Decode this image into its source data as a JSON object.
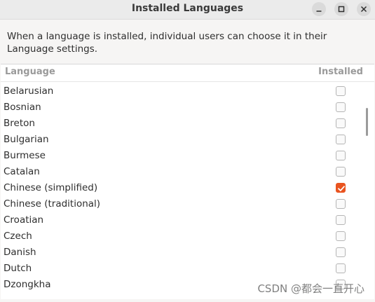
{
  "window": {
    "title": "Installed Languages"
  },
  "description": "When a language is installed, individual users can choose it in their Language settings.",
  "columns": {
    "language": "Language",
    "installed": "Installed"
  },
  "languages": [
    {
      "name": "Belarusian",
      "installed": false
    },
    {
      "name": "Bosnian",
      "installed": false
    },
    {
      "name": "Breton",
      "installed": false
    },
    {
      "name": "Bulgarian",
      "installed": false
    },
    {
      "name": "Burmese",
      "installed": false
    },
    {
      "name": "Catalan",
      "installed": false
    },
    {
      "name": "Chinese (simplified)",
      "installed": true
    },
    {
      "name": "Chinese (traditional)",
      "installed": false
    },
    {
      "name": "Croatian",
      "installed": false
    },
    {
      "name": "Czech",
      "installed": false
    },
    {
      "name": "Danish",
      "installed": false
    },
    {
      "name": "Dutch",
      "installed": false
    },
    {
      "name": "Dzongkha",
      "installed": false
    }
  ],
  "watermark": "CSDN @都会一直开心",
  "colors": {
    "accent": "#e95420",
    "header_text": "#9a9a9a",
    "background": "#f6f5f4"
  }
}
